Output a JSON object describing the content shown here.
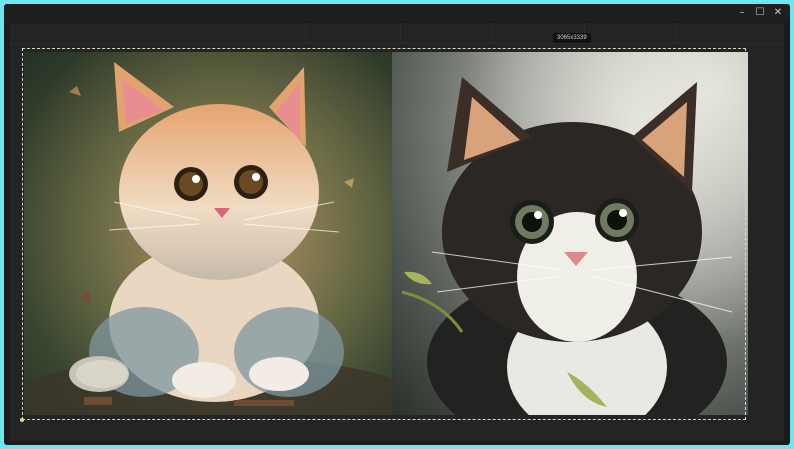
{
  "window": {
    "controls": {
      "minimize": "–",
      "maximize": "☐",
      "close": "✕"
    }
  },
  "canvas": {
    "image_size_badge": "3065x3339"
  },
  "images": {
    "left": {
      "subject": "orange-white-kitten-illustration"
    },
    "right": {
      "subject": "black-white-kitten-illustration"
    }
  },
  "colors": {
    "outer_border": "#6ee6ee",
    "window_bg": "#1b1b1b",
    "canvas_bg": "#242424",
    "selection_border": "#d9d9c8"
  }
}
